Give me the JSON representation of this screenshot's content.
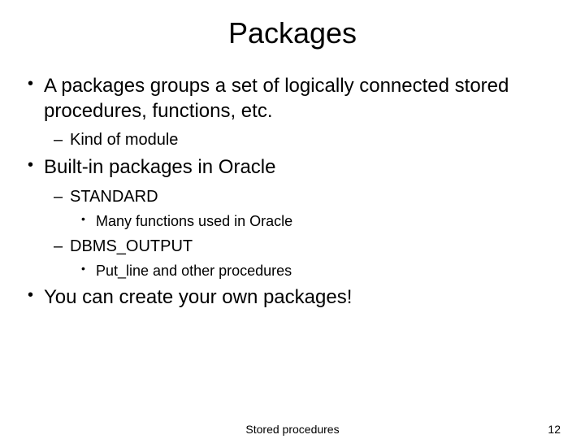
{
  "slide": {
    "title": "Packages",
    "bullets": [
      {
        "level": 1,
        "text": "A packages groups a set of logically connected stored procedures, functions, etc."
      },
      {
        "level": 2,
        "text": "Kind of module"
      },
      {
        "level": 1,
        "text": "Built-in packages in Oracle"
      },
      {
        "level": 2,
        "text": "STANDARD"
      },
      {
        "level": 3,
        "text": "Many functions used in Oracle"
      },
      {
        "level": 2,
        "text": "DBMS_OUTPUT"
      },
      {
        "level": 3,
        "text": "Put_line and other procedures"
      },
      {
        "level": 1,
        "text": "You can create your own packages!"
      }
    ],
    "footer": {
      "center": "Stored procedures",
      "pageNumber": "12"
    }
  }
}
